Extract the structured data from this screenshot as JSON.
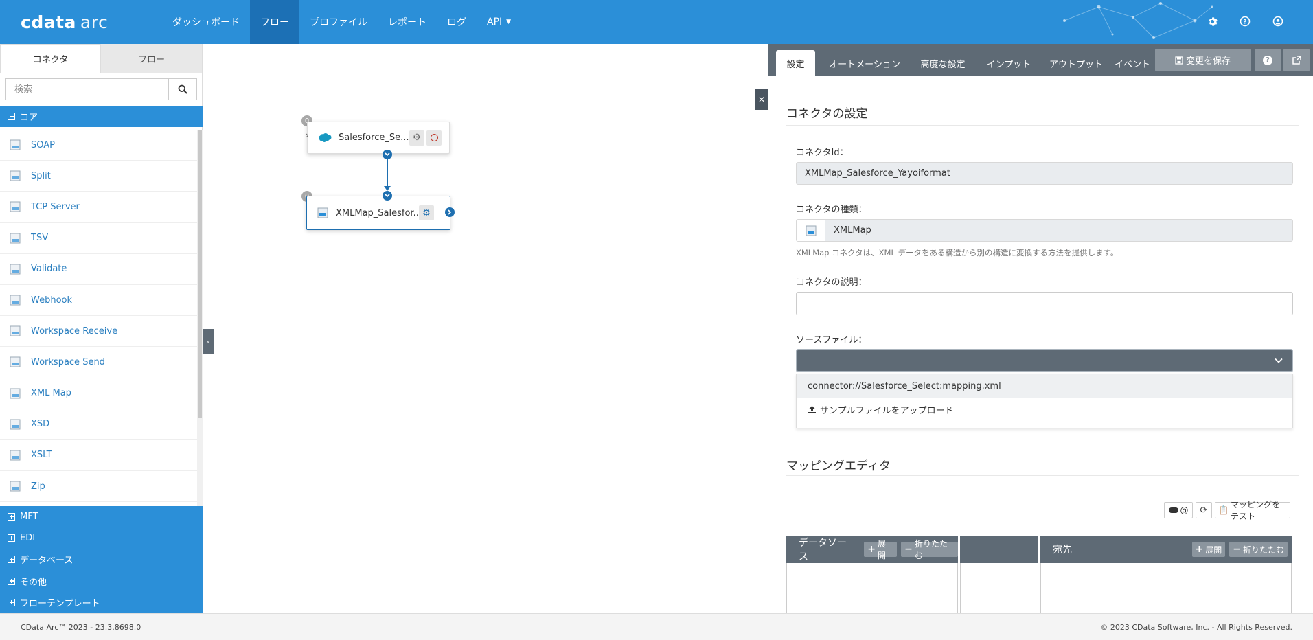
{
  "app": {
    "logo_main": "cdata",
    "logo_sub": "arc"
  },
  "nav": [
    {
      "label": "ダッシュボード"
    },
    {
      "label": "フロー"
    },
    {
      "label": "プロファイル"
    },
    {
      "label": "レポート"
    },
    {
      "label": "ログ"
    },
    {
      "label": "API"
    }
  ],
  "sidebar": {
    "tabs": [
      "コネクタ",
      "フロー"
    ],
    "search_placeholder": "検索",
    "core_label": "コア",
    "connectors": [
      {
        "label": "SOAP",
        "icon": "soap-icon"
      },
      {
        "label": "Split",
        "icon": "split-icon"
      },
      {
        "label": "TCP Server",
        "icon": "tcp-server-icon"
      },
      {
        "label": "TSV",
        "icon": "tsv-icon"
      },
      {
        "label": "Validate",
        "icon": "validate-icon"
      },
      {
        "label": "Webhook",
        "icon": "webhook-icon"
      },
      {
        "label": "Workspace Receive",
        "icon": "workspace-receive-icon"
      },
      {
        "label": "Workspace Send",
        "icon": "workspace-send-icon"
      },
      {
        "label": "XML Map",
        "icon": "xml-map-icon"
      },
      {
        "label": "XSD",
        "icon": "xsd-icon"
      },
      {
        "label": "XSLT",
        "icon": "xslt-icon"
      },
      {
        "label": "Zip",
        "icon": "zip-icon"
      }
    ],
    "categories": [
      "MFT",
      "EDI",
      "データベース",
      "その他",
      "フローテンプレート"
    ]
  },
  "flow": {
    "nodes": [
      {
        "label": "Salesforce_Se...",
        "count": "0"
      },
      {
        "label": "XMLMap_Salesfor...",
        "count": "0"
      }
    ]
  },
  "panel": {
    "tabs": [
      "設定",
      "オートメーション",
      "高度な設定",
      "インプット",
      "アウトプット",
      "イベント"
    ],
    "save_label": "変更を保存",
    "section_title": "コネクタの設定",
    "id_label": "コネクタId：",
    "id_value": "XMLMap_Salesforce_Yayoiformat",
    "type_label": "コネクタの種類：",
    "type_value": "XMLMap",
    "type_help": "XMLMap コネクタは、XML データをある構造から別の構造に変換する方法を提供します。",
    "desc_label": "コネクタの説明：",
    "source_label": "ソースファイル：",
    "source_options": [
      "connector://Salesforce_Select:mapping.xml",
      "サンプルファイルをアップロード"
    ],
    "mapping_title": "マッピングエディタ",
    "mapping_toggle": "@",
    "mapping_test": "マッピングをテスト",
    "source_header": "データソース",
    "dest_header": "宛先",
    "expand": "展開",
    "collapse": "折りたたむ"
  },
  "footer": {
    "version": "CData Arc™ 2023 - 23.3.8698.0",
    "copyright": "© 2023 CData Software, Inc. - All Rights Reserved."
  },
  "colors": {
    "primary": "#2b8fd8",
    "nav_active": "#1c70b5",
    "panel_dark": "#5e6a75",
    "link": "#2a7fc0"
  }
}
